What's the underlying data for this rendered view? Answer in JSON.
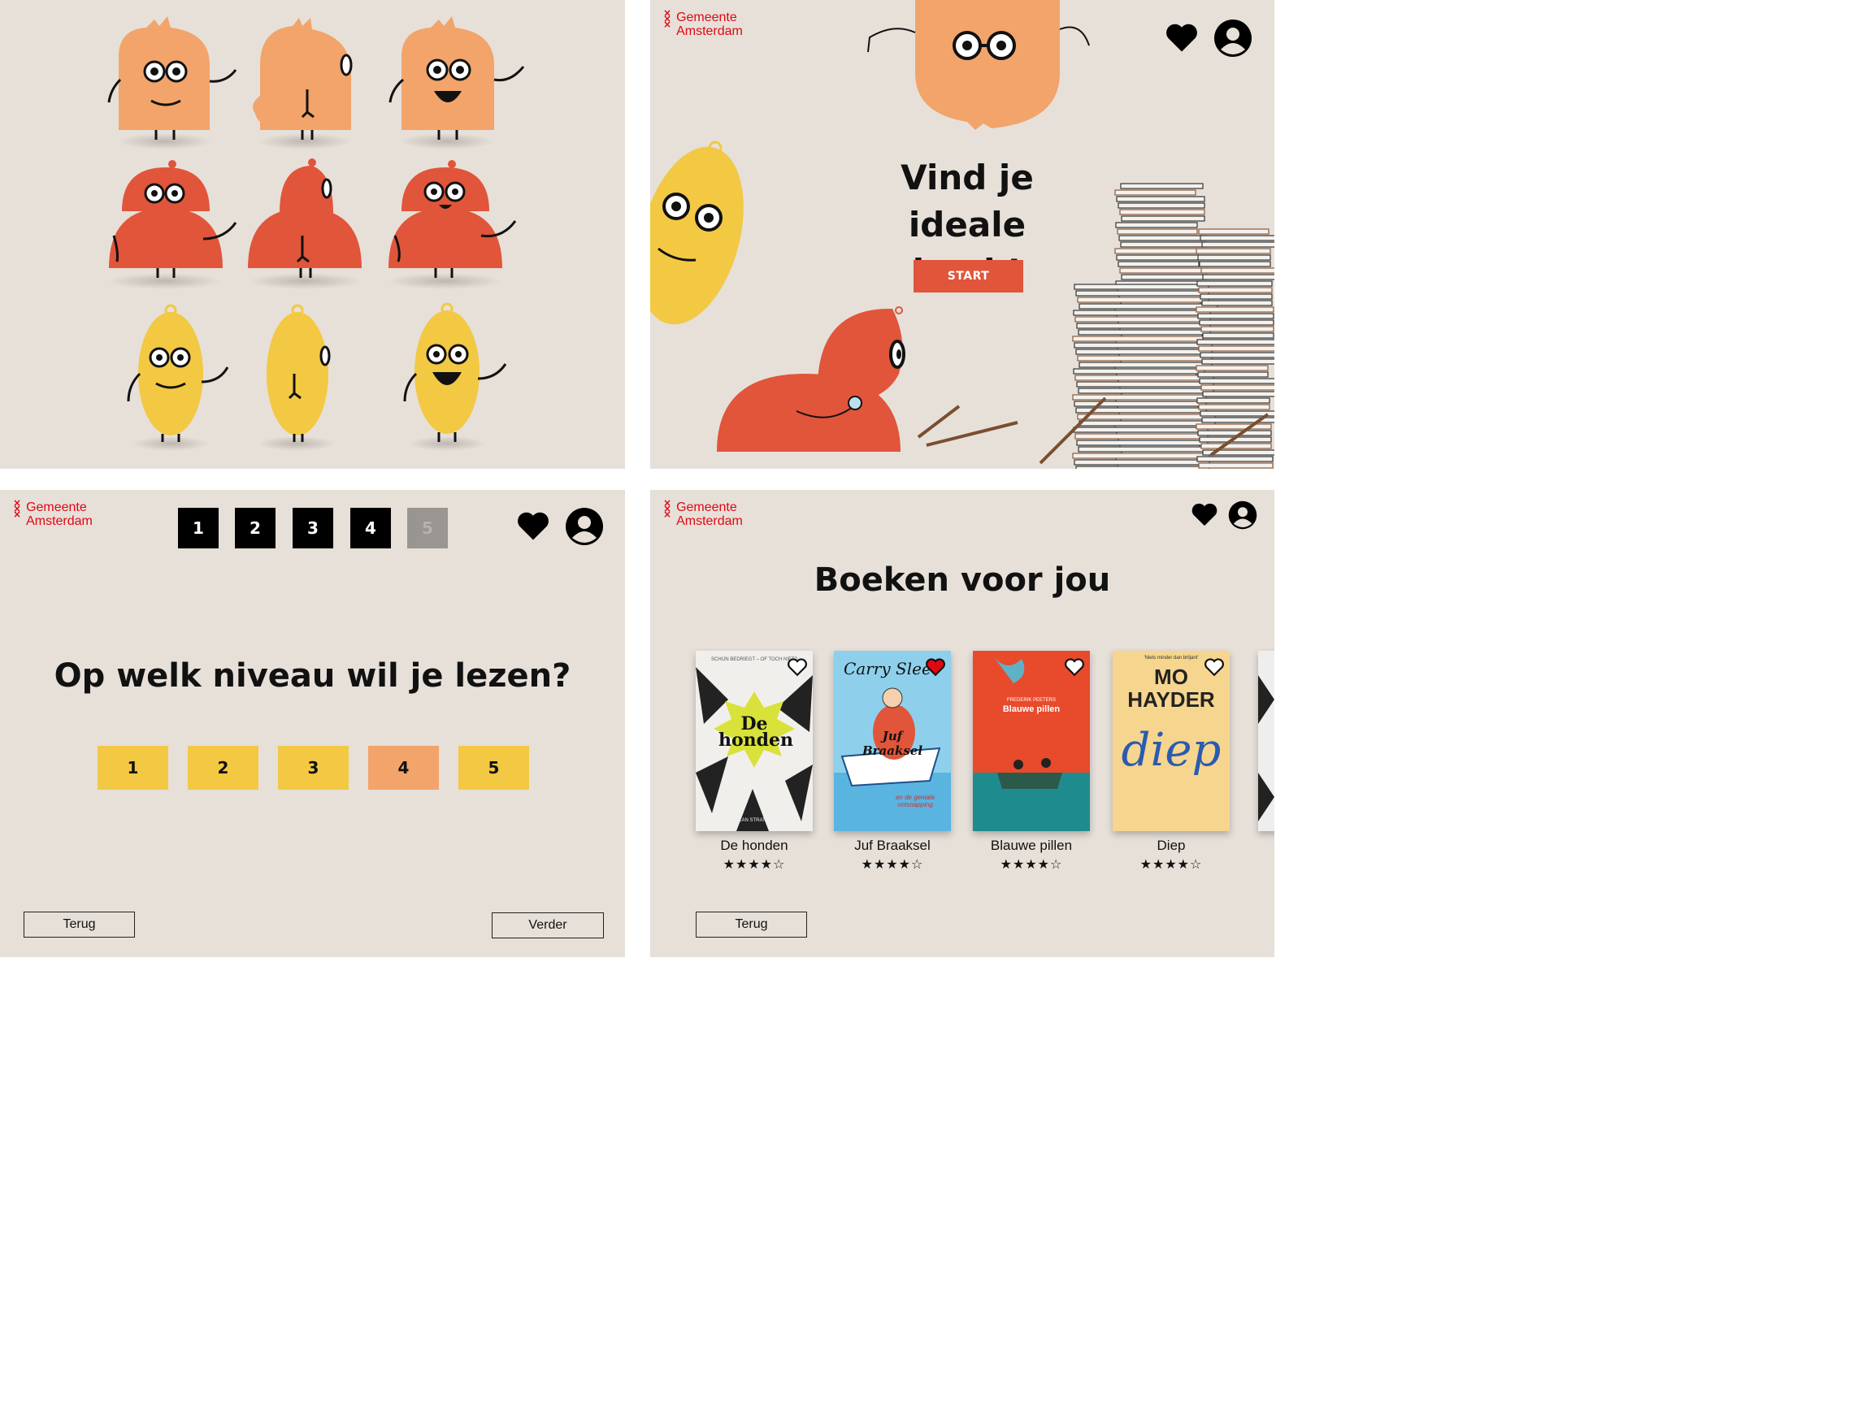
{
  "brand": {
    "line1": "Gemeente",
    "line2": "Amsterdam",
    "color": "#e30613"
  },
  "colors": {
    "background": "#e6e0d9",
    "orange": "#f2a46a",
    "red": "#e1553a",
    "yellow": "#f3c843"
  },
  "home": {
    "title_line1": "Vind je ideale",
    "title_line2": "boek!",
    "start_label": "START",
    "icons": [
      "heart-icon",
      "user-icon"
    ]
  },
  "quiz": {
    "steps": [
      {
        "label": "1",
        "state": "done"
      },
      {
        "label": "2",
        "state": "done"
      },
      {
        "label": "3",
        "state": "done"
      },
      {
        "label": "4",
        "state": "current"
      },
      {
        "label": "5",
        "state": "disabled"
      }
    ],
    "question": "Op welk niveau wil je lezen?",
    "levels": [
      {
        "label": "1",
        "selected": false
      },
      {
        "label": "2",
        "selected": false
      },
      {
        "label": "3",
        "selected": false
      },
      {
        "label": "4",
        "selected": true
      },
      {
        "label": "5",
        "selected": false
      }
    ],
    "back_label": "Terug",
    "next_label": "Verder"
  },
  "results": {
    "title": "Boeken voor jou",
    "books": [
      {
        "title": "De honden",
        "rating": 4,
        "stars": "★★★★☆",
        "favorite": false,
        "cover_text": "De honden",
        "cover_author": "ALLAN STRATTON",
        "cover_top": "SCHIJN BEDRIEGT – OF TOCH NIET?"
      },
      {
        "title": "Juf Braaksel",
        "rating": 4,
        "stars": "★★★★☆",
        "favorite": true,
        "cover_text": "Juf Braaksel",
        "cover_author": "Carry Slee",
        "cover_top": "en de geniale ontsnapping"
      },
      {
        "title": "Blauwe pillen",
        "rating": 4,
        "stars": "★★★★☆",
        "favorite": false,
        "cover_text": "Blauwe pillen",
        "cover_author": "FREDERIK PEETERS",
        "cover_top": ""
      },
      {
        "title": "Diep",
        "rating": 4,
        "stars": "★★★★☆",
        "favorite": false,
        "cover_text": "diep",
        "cover_author": "MO HAYDER",
        "cover_top": "'Niets minder dan briljant'"
      }
    ],
    "back_label": "Terug"
  }
}
